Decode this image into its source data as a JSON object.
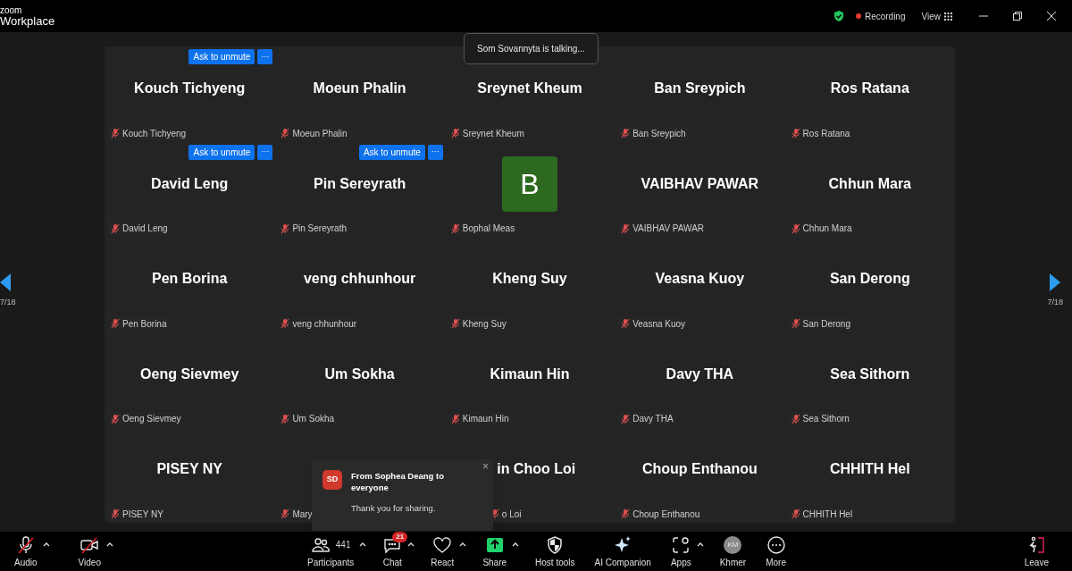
{
  "window": {
    "brand_top": "zoom",
    "brand_bottom": "Workplace",
    "recording": "Recording",
    "view": "View"
  },
  "talking_toast": "Som Sovannyta is talking...",
  "pager": {
    "left": "7/18",
    "right": "7/18"
  },
  "tiles": [
    {
      "kind": "name",
      "name": "Kouch Tichyeng",
      "label": "Kouch Tichyeng",
      "unmute": "Ask to unmute",
      "more": "···"
    },
    {
      "kind": "name",
      "name": "Moeun Phalin",
      "label": "Moeun Phalin"
    },
    {
      "kind": "name",
      "name": "Sreynet Kheum",
      "label": "Sreynet Kheum"
    },
    {
      "kind": "name",
      "name": "Ban Sreypich",
      "label": "Ban Sreypich"
    },
    {
      "kind": "name",
      "name": "Ros Ratana",
      "label": "Ros Ratana"
    },
    {
      "kind": "name",
      "name": "David Leng",
      "label": "David Leng",
      "unmute": "Ask to unmute",
      "more": "···"
    },
    {
      "kind": "name",
      "name": "Pin Sereyrath",
      "label": "Pin Sereyrath",
      "unmute": "Ask to unmute",
      "more": "···"
    },
    {
      "kind": "avatar",
      "initial": "B",
      "color": "#2d6a1f",
      "label": "Bophal Meas"
    },
    {
      "kind": "name",
      "name": "VAIBHAV PAWAR",
      "label": "VAIBHAV PAWAR"
    },
    {
      "kind": "name",
      "name": "Chhun Mara",
      "label": "Chhun Mara"
    },
    {
      "kind": "name",
      "name": "Pen Borina",
      "label": "Pen Borina"
    },
    {
      "kind": "name",
      "name": "veng chhunhour",
      "label": "veng chhunhour"
    },
    {
      "kind": "name",
      "name": "Kheng Suy",
      "label": "Kheng Suy"
    },
    {
      "kind": "name",
      "name": "Veasna Kuoy",
      "label": "Veasna Kuoy"
    },
    {
      "kind": "name",
      "name": "San Derong",
      "label": "San Derong"
    },
    {
      "kind": "name",
      "name": "Oeng Sievmey",
      "label": "Oeng Sievmey"
    },
    {
      "kind": "name",
      "name": "Um Sokha",
      "label": "Um Sokha"
    },
    {
      "kind": "name",
      "name": "Kimaun Hin",
      "label": "Kimaun Hin"
    },
    {
      "kind": "name",
      "name": "Davy THA",
      "label": "Davy THA"
    },
    {
      "kind": "name",
      "name": "Sea Sithorn",
      "label": "Sea Sithorn"
    },
    {
      "kind": "name",
      "name": "PISEY NY",
      "label": "PISEY NY"
    },
    {
      "kind": "covered",
      "label": "Mary"
    },
    {
      "kind": "partial",
      "name": "in Choo Loi",
      "label": "o Loi"
    },
    {
      "kind": "name",
      "name": "Choup Enthanou",
      "label": "Choup Enthanou"
    },
    {
      "kind": "name",
      "name": "CHHITH Hel",
      "label": "CHHITH Hel"
    }
  ],
  "chat_popup": {
    "initials": "SD",
    "title": "From Sophea Deang to everyone",
    "message": "Thank you for sharing.",
    "close": "×"
  },
  "toolbar": [
    {
      "kind": "mic",
      "label": "Audio",
      "muted": true,
      "caret": true
    },
    {
      "kind": "video",
      "label": "Video",
      "muted": true,
      "caret": true
    },
    {
      "kind": "participants",
      "label": "Participants",
      "count": "441",
      "caret": true
    },
    {
      "kind": "chat",
      "label": "Chat",
      "badge": "21",
      "caret": true
    },
    {
      "kind": "react",
      "label": "React",
      "caret": true
    },
    {
      "kind": "share",
      "label": "Share",
      "caret": true
    },
    {
      "kind": "host",
      "label": "Host tools",
      "caret": false
    },
    {
      "kind": "ai",
      "label": "AI Companion",
      "caret": false
    },
    {
      "kind": "apps",
      "label": "Apps",
      "caret": true
    },
    {
      "kind": "avatar",
      "label": "Khmer",
      "initials": "KM",
      "caret": false
    },
    {
      "kind": "more",
      "label": "More",
      "caret": false
    },
    {
      "kind": "leave",
      "label": "Leave",
      "caret": false
    }
  ]
}
